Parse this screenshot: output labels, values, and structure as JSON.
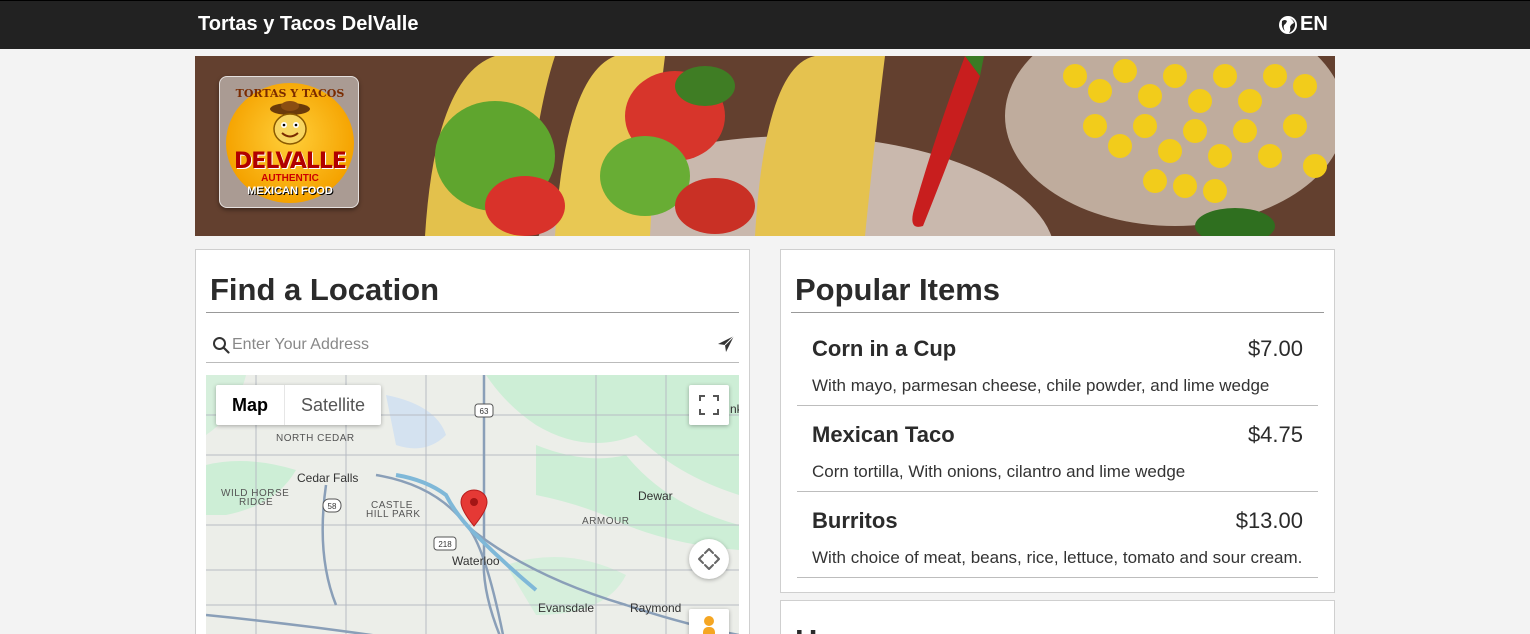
{
  "header": {
    "brand": "Tortas y Tacos DelValle",
    "language": "EN",
    "language_icon": "globe-icon"
  },
  "banner": {
    "logo": {
      "top_text": "TORTAS Y TACOS",
      "name": "DELVALLE",
      "sub1": "AUTHENTIC",
      "sub2": "MEXICAN FOOD"
    }
  },
  "find_location": {
    "title": "Find a Location",
    "search_placeholder": "Enter Your Address",
    "search_icon": "search-icon",
    "submit_icon": "send-icon",
    "map": {
      "type_buttons": [
        "Map",
        "Satellite"
      ],
      "selected_type": "Map",
      "labels": {
        "north_cedar": "NORTH CEDAR",
        "cedar_falls": "Cedar Falls",
        "wild_horse_1": "WILD HORSE",
        "wild_horse_2": "RIDGE",
        "castle_hill_1": "CASTLE",
        "castle_hill_2": "HILL PARK",
        "dewar": "Dewar",
        "armour": "ARMOUR",
        "waterloo": "Waterloo",
        "evansdale": "Evansdale",
        "raymond": "Raymond",
        "edge_text": "nk",
        "route_63": "63",
        "route_58": "58",
        "route_218": "218"
      }
    }
  },
  "popular_items": {
    "title": "Popular Items",
    "items": [
      {
        "name": "Corn in a Cup",
        "price": "$7.00",
        "description": "With mayo, parmesan cheese, chile powder, and lime wedge"
      },
      {
        "name": "Mexican Taco",
        "price": "$4.75",
        "description": "Corn tortilla, With onions, cilantro and lime wedge"
      },
      {
        "name": "Burritos",
        "price": "$13.00",
        "description": "With choice of meat, beans, rice, lettuce, tomato and sour cream."
      }
    ]
  },
  "hours": {
    "title": "Hours"
  },
  "colors": {
    "topbar": "#222222",
    "page_bg": "#f3f3f3",
    "map_pin": "#e53935"
  }
}
